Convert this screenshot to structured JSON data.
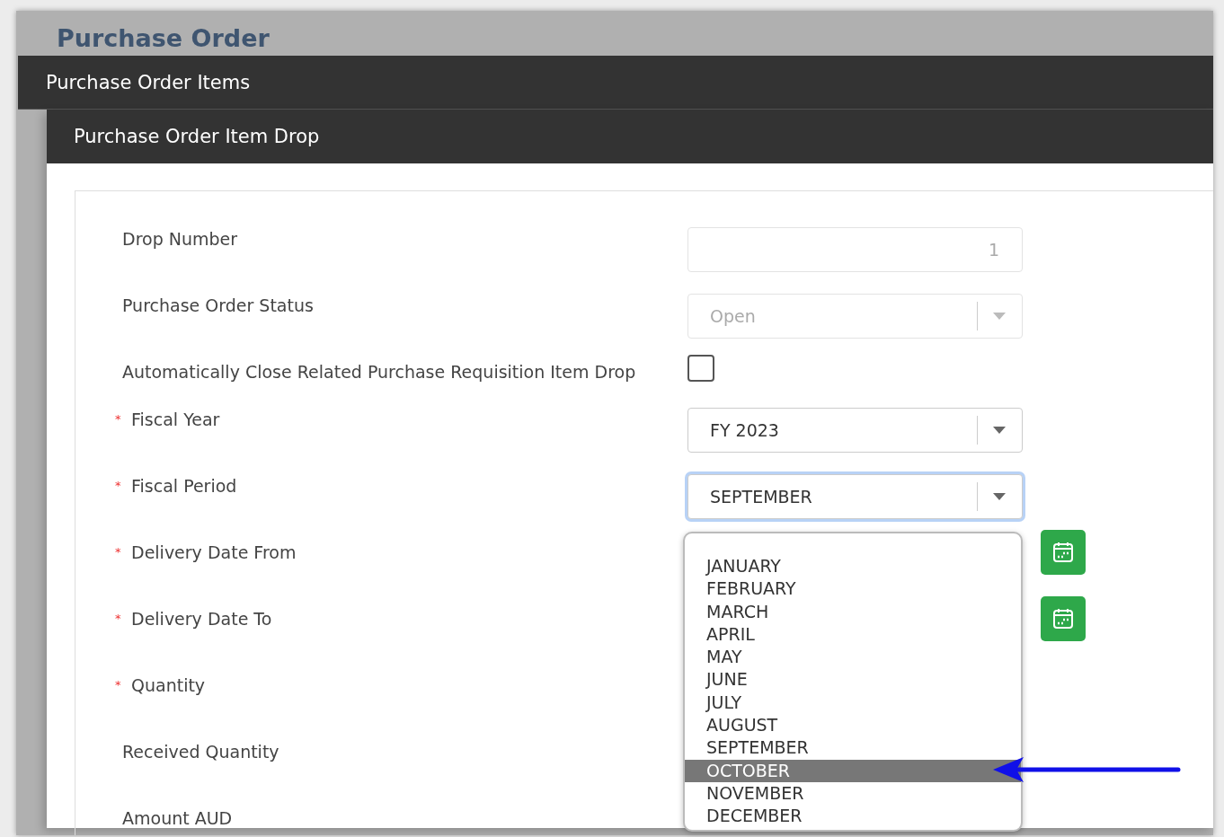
{
  "page_title": "Purchase Order",
  "section_bar": {
    "title": "Purchase Order Items"
  },
  "subsection_bar": {
    "title": "Purchase Order Item Drop"
  },
  "fields": [
    {
      "label": "Drop Number",
      "required": false,
      "kind": "text",
      "value": "1",
      "disabled": true
    },
    {
      "label": "Purchase Order Status",
      "required": false,
      "kind": "select",
      "value": "Open",
      "disabled": true
    },
    {
      "label": "Automatically Close Related Purchase Requisition Item Drop",
      "required": false,
      "kind": "checkbox",
      "checked": false
    },
    {
      "label": "Fiscal Year",
      "required": true,
      "required_mark": "*",
      "kind": "select",
      "value": "FY 2023",
      "disabled": false
    },
    {
      "label": "Fiscal Period",
      "required": true,
      "required_mark": "*",
      "kind": "select",
      "value": "SEPTEMBER",
      "disabled": false,
      "expanded": true,
      "options": [
        {
          "label": "JANUARY",
          "highlighted": false
        },
        {
          "label": "FEBRUARY",
          "highlighted": false
        },
        {
          "label": "MARCH",
          "highlighted": false
        },
        {
          "label": "APRIL",
          "highlighted": false
        },
        {
          "label": "MAY",
          "highlighted": false
        },
        {
          "label": "JUNE",
          "highlighted": false
        },
        {
          "label": "JULY",
          "highlighted": false
        },
        {
          "label": "AUGUST",
          "highlighted": false
        },
        {
          "label": "SEPTEMBER",
          "highlighted": false
        },
        {
          "label": "OCTOBER",
          "highlighted": true
        },
        {
          "label": "NOVEMBER",
          "highlighted": false
        },
        {
          "label": "DECEMBER",
          "highlighted": false
        }
      ]
    },
    {
      "label": "Delivery Date From",
      "required": true,
      "required_mark": "*",
      "kind": "date"
    },
    {
      "label": "Delivery Date To",
      "required": true,
      "required_mark": "*",
      "kind": "date"
    },
    {
      "label": "Quantity",
      "required": true,
      "required_mark": "*",
      "kind": "covered"
    },
    {
      "label": "Received Quantity",
      "required": false,
      "kind": "covered"
    },
    {
      "label": "Amount AUD",
      "required": false,
      "kind": "covered"
    }
  ]
}
